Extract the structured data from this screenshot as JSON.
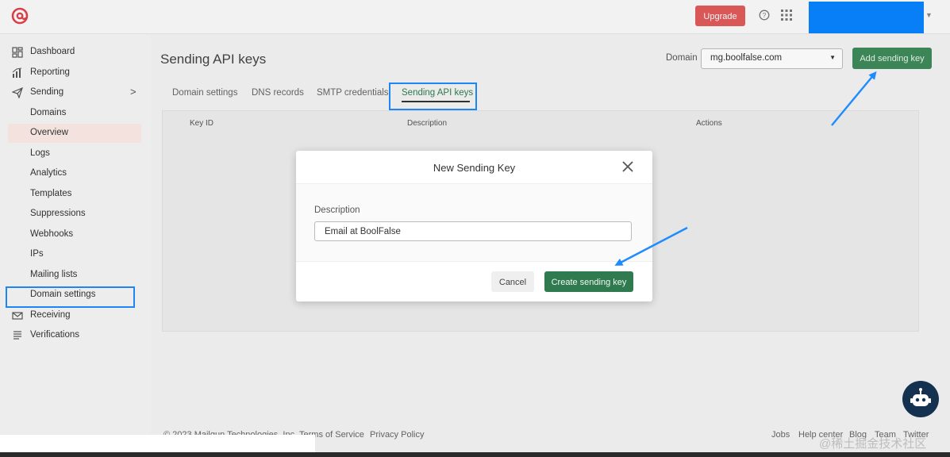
{
  "topbar": {
    "upgrade_label": "Upgrade",
    "icons": [
      "mailgun-logo-icon",
      "help-icon",
      "apps-grid-icon",
      "chevron-down-icon"
    ]
  },
  "sidebar": {
    "items": [
      {
        "label": "Dashboard",
        "icon": "dashboard-icon"
      },
      {
        "label": "Reporting",
        "icon": "reporting-icon"
      },
      {
        "label": "Sending",
        "icon": "send-icon"
      },
      {
        "label": "Domains"
      },
      {
        "label": "Overview"
      },
      {
        "label": "Logs"
      },
      {
        "label": "Analytics"
      },
      {
        "label": "Templates"
      },
      {
        "label": "Suppressions"
      },
      {
        "label": "Webhooks"
      },
      {
        "label": "IPs"
      },
      {
        "label": "Mailing lists"
      },
      {
        "label": "Domain settings"
      },
      {
        "label": "Receiving",
        "icon": "mail-icon"
      },
      {
        "label": "Verifications",
        "icon": "list-icon"
      }
    ]
  },
  "main": {
    "title": "Sending API keys",
    "domain_label": "Domain",
    "domain_value": "mg.boolfalse.com",
    "add_key_label": "Add sending key",
    "tabs": [
      {
        "label": "Domain settings"
      },
      {
        "label": "DNS records"
      },
      {
        "label": "SMTP credentials"
      },
      {
        "label": "Sending API keys"
      }
    ],
    "table_headers": [
      "Key ID",
      "Description",
      "Actions"
    ]
  },
  "modal": {
    "title": "New Sending Key",
    "field_label": "Description",
    "field_value": "Email at BoolFalse",
    "cancel_label": "Cancel",
    "create_label": "Create sending key"
  },
  "footer": {
    "copyright": "© 2023 Mailgun Technologies, Inc.",
    "terms": "Terms of Service",
    "privacy": "Privacy Policy",
    "jobs": "Jobs",
    "help_center": "Help center",
    "blog": "Blog",
    "team": "Team",
    "twitter": "Twitter"
  },
  "watermark": "@稀土掘金技术社区",
  "colors": {
    "brand_red": "#e05a5a",
    "primary_green": "#2f7b4f",
    "annotation_blue": "#1e8bff"
  }
}
